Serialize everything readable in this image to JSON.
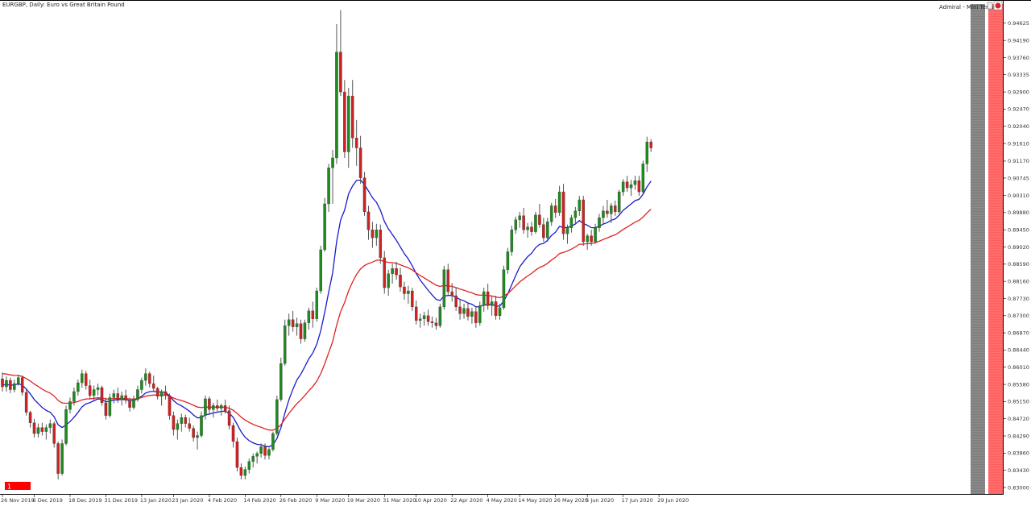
{
  "window": {
    "title": "EURGBP, Daily: Euro vs Great Britain Pound",
    "expert_label": "Admiral - Mini Termi",
    "smile_icon": "smiley-icon",
    "badge_label": "1"
  },
  "colors": {
    "bull": "#1f8a1f",
    "bear": "#cc2222",
    "wick": "#555555",
    "ma_fast": "#1a1acc",
    "ma_slow": "#e02222",
    "gray_panel": "#8c8c8c",
    "red_panel": "#ff7070",
    "badge": "#ff0000"
  },
  "chart_data": {
    "type": "candlestick",
    "symbol": "EURGBP",
    "timeframe": "Daily",
    "title": "EURGBP, Daily: Euro vs Great Britain Pound",
    "ylim": [
      0.83,
      0.95
    ],
    "y_ticks": [
      "0.94625",
      "0.94190",
      "0.93760",
      "0.93335",
      "0.92900",
      "0.92470",
      "0.92040",
      "0.91610",
      "0.91170",
      "0.90745",
      "0.90310",
      "0.89880",
      "0.89450",
      "0.89020",
      "0.88590",
      "0.88160",
      "0.87730",
      "0.87300",
      "0.86870",
      "0.86440",
      "0.86010",
      "0.85580",
      "0.85150",
      "0.84720",
      "0.84290",
      "0.83860",
      "0.83430",
      "0.83000"
    ],
    "y_tick_values": [
      0.94625,
      0.9419,
      0.9376,
      0.93335,
      0.929,
      0.9247,
      0.9204,
      0.9161,
      0.9117,
      0.90745,
      0.9031,
      0.8988,
      0.8945,
      0.8902,
      0.8859,
      0.8816,
      0.8773,
      0.873,
      0.8687,
      0.8644,
      0.8601,
      0.8558,
      0.8515,
      0.8472,
      0.8429,
      0.8386,
      0.8343,
      0.83
    ],
    "x_ticks": [
      "26 Nov 2019",
      "6 Dec 2019",
      "18 Dec 2019",
      "31 Dec 2019",
      "13 Jan 2020",
      "23 Jan 2020",
      "4 Feb 2020",
      "14 Feb 2020",
      "26 Feb 2020",
      "9 Mar 2020",
      "19 Mar 2020",
      "31 Mar 2020",
      "10 Apr 2020",
      "22 Apr 2020",
      "4 May 2020",
      "14 May 2020",
      "26 May 2020",
      "5 Jun 2020",
      "17 Jun 2020",
      "29 Jun 2020"
    ],
    "x_tick_index": [
      0,
      8,
      17,
      26,
      35,
      43,
      52,
      61,
      70,
      79,
      87,
      96,
      104,
      113,
      122,
      130,
      139,
      147,
      156,
      165
    ],
    "series": [
      {
        "kind": "ohlc",
        "ohlc": [
          [
            0.8572,
            0.8588,
            0.854,
            0.8552
          ],
          [
            0.8552,
            0.8578,
            0.854,
            0.8568
          ],
          [
            0.8568,
            0.8575,
            0.8536,
            0.8545
          ],
          [
            0.8545,
            0.857,
            0.8538,
            0.856
          ],
          [
            0.856,
            0.8582,
            0.8555,
            0.8575
          ],
          [
            0.8575,
            0.858,
            0.853,
            0.8538
          ],
          [
            0.8538,
            0.8545,
            0.848,
            0.8488
          ],
          [
            0.8488,
            0.8492,
            0.845,
            0.8462
          ],
          [
            0.8462,
            0.8472,
            0.8425,
            0.8435
          ],
          [
            0.8435,
            0.846,
            0.8425,
            0.845
          ],
          [
            0.845,
            0.8462,
            0.843,
            0.844
          ],
          [
            0.844,
            0.8458,
            0.842,
            0.845
          ],
          [
            0.845,
            0.847,
            0.8435,
            0.846
          ],
          [
            0.846,
            0.8465,
            0.84,
            0.841
          ],
          [
            0.841,
            0.8415,
            0.832,
            0.8335
          ],
          [
            0.8335,
            0.842,
            0.833,
            0.841
          ],
          [
            0.841,
            0.8505,
            0.8405,
            0.8495
          ],
          [
            0.8495,
            0.8525,
            0.8485,
            0.8515
          ],
          [
            0.8515,
            0.855,
            0.8505,
            0.854
          ],
          [
            0.854,
            0.857,
            0.853,
            0.8562
          ],
          [
            0.8562,
            0.8595,
            0.855,
            0.8585
          ],
          [
            0.8585,
            0.8592,
            0.8545,
            0.8555
          ],
          [
            0.8555,
            0.857,
            0.852,
            0.853
          ],
          [
            0.853,
            0.8555,
            0.8515,
            0.8545
          ],
          [
            0.8545,
            0.856,
            0.853,
            0.855
          ],
          [
            0.855,
            0.8555,
            0.8505,
            0.8512
          ],
          [
            0.8512,
            0.8525,
            0.847,
            0.848
          ],
          [
            0.848,
            0.8535,
            0.8475,
            0.8525
          ],
          [
            0.8525,
            0.8545,
            0.851,
            0.8535
          ],
          [
            0.8535,
            0.855,
            0.8512,
            0.852
          ],
          [
            0.852,
            0.854,
            0.8505,
            0.853
          ],
          [
            0.853,
            0.8545,
            0.851,
            0.8518
          ],
          [
            0.8518,
            0.8525,
            0.849,
            0.85
          ],
          [
            0.85,
            0.853,
            0.8495,
            0.852
          ],
          [
            0.852,
            0.8555,
            0.8515,
            0.8545
          ],
          [
            0.8545,
            0.8575,
            0.8535,
            0.8568
          ],
          [
            0.8568,
            0.8598,
            0.8555,
            0.8585
          ],
          [
            0.8585,
            0.859,
            0.855,
            0.856
          ],
          [
            0.856,
            0.858,
            0.854,
            0.8548
          ],
          [
            0.8548,
            0.8552,
            0.852,
            0.8528
          ],
          [
            0.8528,
            0.8545,
            0.8505,
            0.854
          ],
          [
            0.854,
            0.8555,
            0.852,
            0.853
          ],
          [
            0.853,
            0.8535,
            0.847,
            0.848
          ],
          [
            0.848,
            0.849,
            0.843,
            0.8445
          ],
          [
            0.8445,
            0.847,
            0.842,
            0.846
          ],
          [
            0.846,
            0.8485,
            0.844,
            0.8475
          ],
          [
            0.8475,
            0.8482,
            0.845,
            0.846
          ],
          [
            0.846,
            0.8475,
            0.844,
            0.8448
          ],
          [
            0.8448,
            0.8455,
            0.8415,
            0.8425
          ],
          [
            0.8425,
            0.844,
            0.8395,
            0.843
          ],
          [
            0.843,
            0.849,
            0.8425,
            0.848
          ],
          [
            0.848,
            0.853,
            0.847,
            0.8522
          ],
          [
            0.8522,
            0.8528,
            0.8485,
            0.8495
          ],
          [
            0.8495,
            0.8512,
            0.8475,
            0.8505
          ],
          [
            0.8505,
            0.852,
            0.849,
            0.8498
          ],
          [
            0.8498,
            0.851,
            0.848,
            0.8505
          ],
          [
            0.8505,
            0.852,
            0.8485,
            0.8492
          ],
          [
            0.8492,
            0.8505,
            0.8445,
            0.8455
          ],
          [
            0.8455,
            0.8462,
            0.84,
            0.8415
          ],
          [
            0.8415,
            0.8425,
            0.834,
            0.835
          ],
          [
            0.835,
            0.836,
            0.832,
            0.833
          ],
          [
            0.833,
            0.8352,
            0.832,
            0.8345
          ],
          [
            0.8345,
            0.8372,
            0.8335,
            0.8365
          ],
          [
            0.8365,
            0.8385,
            0.835,
            0.8378
          ],
          [
            0.8378,
            0.839,
            0.836,
            0.8385
          ],
          [
            0.8385,
            0.841,
            0.8375,
            0.8402
          ],
          [
            0.8402,
            0.841,
            0.837,
            0.838
          ],
          [
            0.838,
            0.84,
            0.837,
            0.8395
          ],
          [
            0.8395,
            0.844,
            0.839,
            0.8435
          ],
          [
            0.8435,
            0.853,
            0.843,
            0.852
          ],
          [
            0.852,
            0.8625,
            0.8515,
            0.861
          ],
          [
            0.861,
            0.872,
            0.8605,
            0.8705
          ],
          [
            0.8705,
            0.8735,
            0.868,
            0.872
          ],
          [
            0.872,
            0.8742,
            0.869,
            0.8702
          ],
          [
            0.8702,
            0.8725,
            0.868,
            0.871
          ],
          [
            0.871,
            0.872,
            0.866,
            0.8672
          ],
          [
            0.8672,
            0.872,
            0.8665,
            0.8712
          ],
          [
            0.8712,
            0.875,
            0.8695,
            0.8742
          ],
          [
            0.8742,
            0.8765,
            0.87,
            0.8722
          ],
          [
            0.8722,
            0.88,
            0.8715,
            0.8792
          ],
          [
            0.8792,
            0.8905,
            0.8785,
            0.8895
          ],
          [
            0.8895,
            0.9025,
            0.889,
            0.901
          ],
          [
            0.901,
            0.911,
            0.899,
            0.91
          ],
          [
            0.91,
            0.9145,
            0.901,
            0.9125
          ],
          [
            0.9125,
            0.946,
            0.911,
            0.939
          ],
          [
            0.939,
            0.9495,
            0.928,
            0.929
          ],
          [
            0.929,
            0.932,
            0.9125,
            0.914
          ],
          [
            0.914,
            0.93,
            0.91,
            0.928
          ],
          [
            0.928,
            0.932,
            0.915,
            0.9175
          ],
          [
            0.9175,
            0.922,
            0.9105,
            0.915
          ],
          [
            0.915,
            0.918,
            0.906,
            0.9075
          ],
          [
            0.9075,
            0.909,
            0.898,
            0.899
          ],
          [
            0.899,
            0.9005,
            0.892,
            0.8945
          ],
          [
            0.8945,
            0.8965,
            0.89,
            0.8925
          ],
          [
            0.8925,
            0.896,
            0.8905,
            0.8945
          ],
          [
            0.8945,
            0.8958,
            0.886,
            0.8875
          ],
          [
            0.8875,
            0.8892,
            0.8785,
            0.88
          ],
          [
            0.88,
            0.8845,
            0.878,
            0.8835
          ],
          [
            0.8835,
            0.886,
            0.881,
            0.8848
          ],
          [
            0.8848,
            0.8865,
            0.882,
            0.8832
          ],
          [
            0.8832,
            0.885,
            0.879,
            0.8802
          ],
          [
            0.8802,
            0.8815,
            0.877,
            0.8785
          ],
          [
            0.8785,
            0.8805,
            0.876,
            0.8792
          ],
          [
            0.8792,
            0.88,
            0.8742,
            0.8752
          ],
          [
            0.8752,
            0.8768,
            0.8708,
            0.8718
          ],
          [
            0.8718,
            0.8735,
            0.87,
            0.8722
          ],
          [
            0.8722,
            0.874,
            0.8705,
            0.873
          ],
          [
            0.873,
            0.8745,
            0.8705,
            0.8715
          ],
          [
            0.8715,
            0.8728,
            0.87,
            0.8712
          ],
          [
            0.8712,
            0.8725,
            0.8695,
            0.8705
          ],
          [
            0.8705,
            0.876,
            0.87,
            0.8752
          ],
          [
            0.8752,
            0.8855,
            0.8745,
            0.8845
          ],
          [
            0.8845,
            0.886,
            0.878,
            0.879
          ],
          [
            0.879,
            0.8812,
            0.8765,
            0.878
          ],
          [
            0.878,
            0.88,
            0.8742,
            0.8752
          ],
          [
            0.8752,
            0.877,
            0.872,
            0.8735
          ],
          [
            0.8735,
            0.876,
            0.8722,
            0.8748
          ],
          [
            0.8748,
            0.876,
            0.8718,
            0.8728
          ],
          [
            0.8728,
            0.875,
            0.871,
            0.874
          ],
          [
            0.874,
            0.8752,
            0.87,
            0.8712
          ],
          [
            0.8712,
            0.8765,
            0.8705,
            0.8755
          ],
          [
            0.8755,
            0.88,
            0.874,
            0.879
          ],
          [
            0.879,
            0.881,
            0.8745,
            0.8755
          ],
          [
            0.8755,
            0.8778,
            0.873,
            0.8765
          ],
          [
            0.8765,
            0.878,
            0.872,
            0.873
          ],
          [
            0.873,
            0.876,
            0.872,
            0.875
          ],
          [
            0.875,
            0.8855,
            0.8745,
            0.8845
          ],
          [
            0.8845,
            0.89,
            0.8835,
            0.889
          ],
          [
            0.889,
            0.8955,
            0.888,
            0.8945
          ],
          [
            0.8945,
            0.8978,
            0.8935,
            0.897
          ],
          [
            0.897,
            0.899,
            0.895,
            0.898
          ],
          [
            0.898,
            0.9,
            0.8935,
            0.8945
          ],
          [
            0.8945,
            0.8962,
            0.8925,
            0.8952
          ],
          [
            0.8952,
            0.8965,
            0.893,
            0.894
          ],
          [
            0.894,
            0.899,
            0.8935,
            0.8982
          ],
          [
            0.8982,
            0.901,
            0.895,
            0.8958
          ],
          [
            0.8958,
            0.8975,
            0.8915,
            0.8925
          ],
          [
            0.8925,
            0.8975,
            0.8915,
            0.8965
          ],
          [
            0.8965,
            0.9012,
            0.8955,
            0.9005
          ],
          [
            0.9005,
            0.9022,
            0.8975,
            0.8988
          ],
          [
            0.8988,
            0.9055,
            0.898,
            0.904
          ],
          [
            0.904,
            0.906,
            0.892,
            0.8935
          ],
          [
            0.8935,
            0.8958,
            0.891,
            0.895
          ],
          [
            0.895,
            0.8982,
            0.8938,
            0.8975
          ],
          [
            0.8975,
            0.9002,
            0.896,
            0.8992
          ],
          [
            0.8992,
            0.903,
            0.898,
            0.902
          ],
          [
            0.902,
            0.903,
            0.8905,
            0.8915
          ],
          [
            0.8915,
            0.8935,
            0.8895,
            0.893
          ],
          [
            0.893,
            0.8945,
            0.8905,
            0.8915
          ],
          [
            0.8915,
            0.896,
            0.891,
            0.895
          ],
          [
            0.895,
            0.8985,
            0.894,
            0.8975
          ],
          [
            0.8975,
            0.9005,
            0.896,
            0.8992
          ],
          [
            0.8992,
            0.902,
            0.8975,
            0.8985
          ],
          [
            0.8985,
            0.9012,
            0.8962,
            0.9005
          ],
          [
            0.9005,
            0.9018,
            0.898,
            0.899
          ],
          [
            0.899,
            0.9045,
            0.8985,
            0.904
          ],
          [
            0.904,
            0.9072,
            0.903,
            0.9065
          ],
          [
            0.9065,
            0.908,
            0.904,
            0.905
          ],
          [
            0.905,
            0.907,
            0.903,
            0.9058
          ],
          [
            0.9058,
            0.908,
            0.9045,
            0.9068
          ],
          [
            0.9068,
            0.908,
            0.903,
            0.904
          ],
          [
            0.904,
            0.9118,
            0.9035,
            0.911
          ],
          [
            0.911,
            0.9178,
            0.909,
            0.9165
          ],
          [
            0.9165,
            0.9172,
            0.914,
            0.915
          ]
        ]
      },
      {
        "kind": "ma",
        "period": 13,
        "color_key": "ma_fast"
      },
      {
        "kind": "ma",
        "period": 34,
        "color_key": "ma_slow"
      }
    ]
  }
}
